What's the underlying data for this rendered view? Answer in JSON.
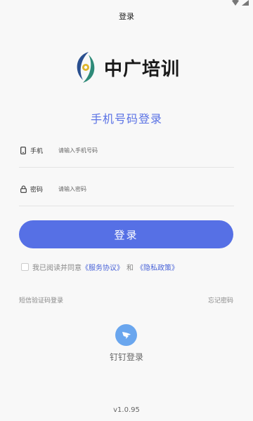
{
  "nav": {
    "title": "登录"
  },
  "logo": {
    "text": "中广培训"
  },
  "heading": "手机号码登录",
  "phone": {
    "label": "手机",
    "placeholder": "请输入手机号码"
  },
  "password": {
    "label": "密码",
    "placeholder": "请输入密码"
  },
  "login_button": "登录",
  "agreement": {
    "prefix": "我已阅读并同意",
    "service_link": "《服务协议》",
    "and": "和",
    "privacy_link": "《隐私政策》"
  },
  "sms_login": "短信验证码登录",
  "forgot_password": "忘记密码",
  "dingtalk": {
    "label": "钉钉登录"
  },
  "version": "v1.0.95",
  "colors": {
    "accent": "#5670e5",
    "link": "#4a64d8",
    "dingtalk": "#6aa6ee",
    "background": "#f8f8f8"
  }
}
